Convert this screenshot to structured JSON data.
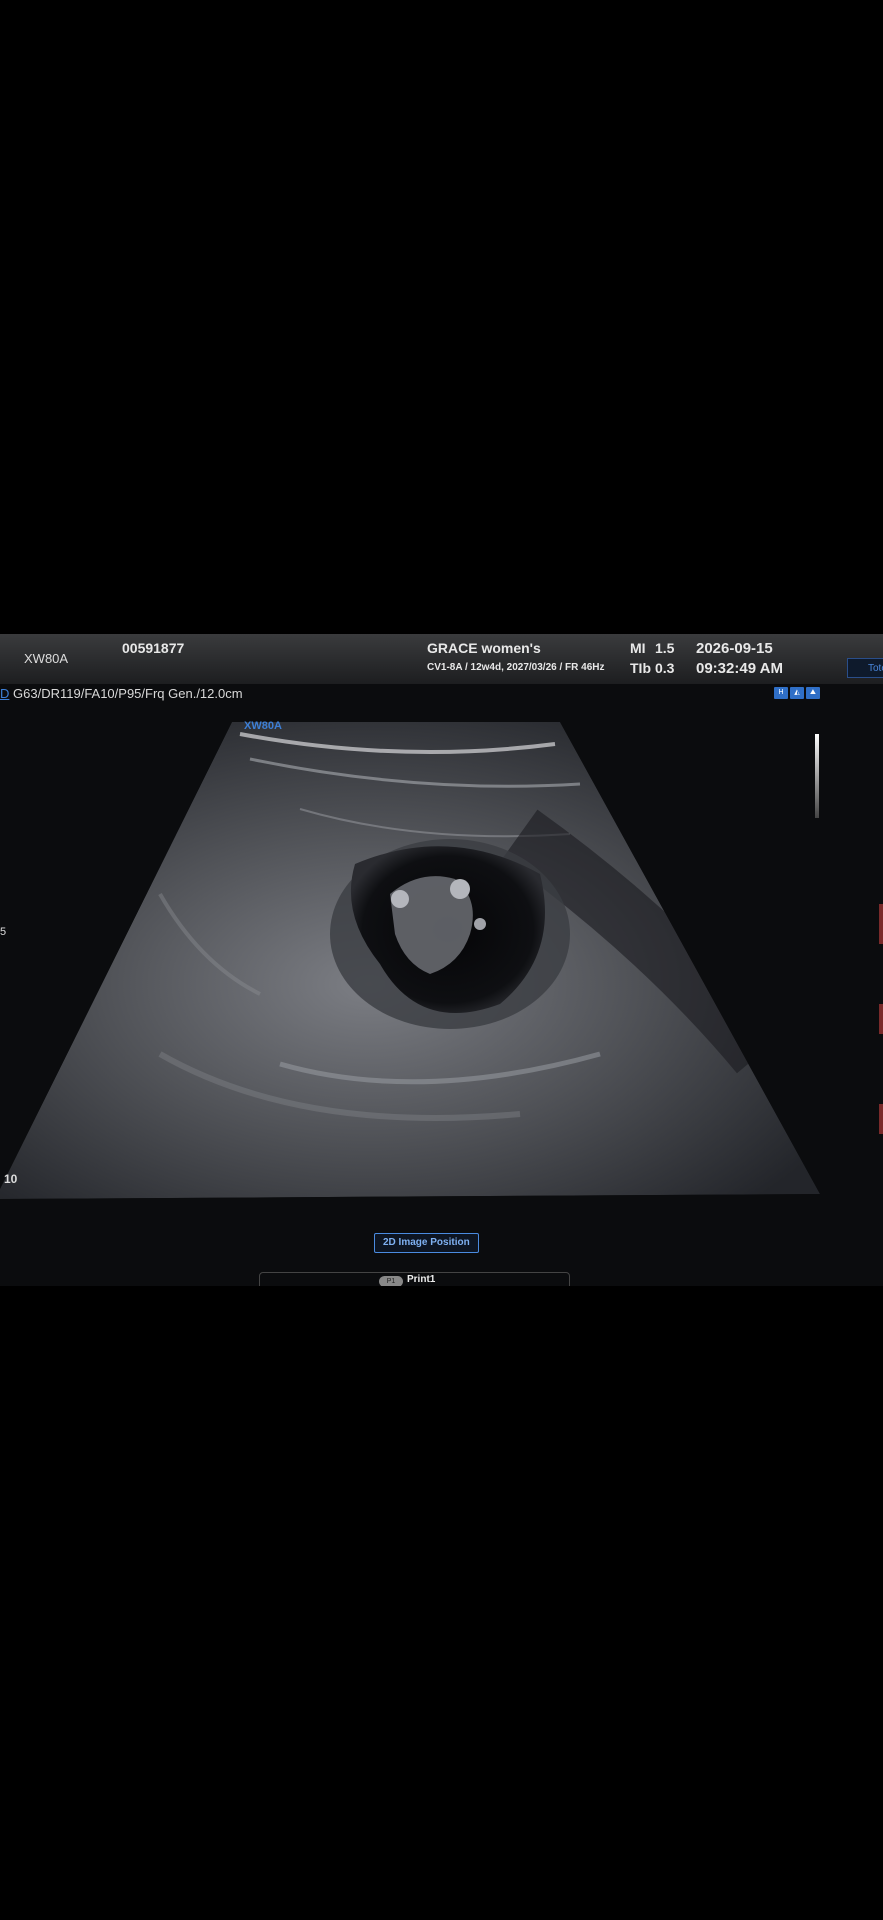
{
  "header": {
    "device_model": "XW80A",
    "patient_id": "00591877",
    "institution": "GRACE women's",
    "scan_info": "CV1-8A / 12w4d, 2027/03/26 / FR 46Hz",
    "mi_label": "MI",
    "mi_value": "1.5",
    "tib_label": "TIb",
    "tib_value": "0.3",
    "date": "2026-09-15",
    "time": "09:32:49 AM",
    "side_tab": "Tote"
  },
  "imaging": {
    "mode": "D",
    "params": "G63/DR119/FA10/P95/Frq Gen./12.0cm",
    "probe_tag": "XW80A",
    "depth_marker": "10",
    "side_marker": "5"
  },
  "controls": {
    "position_button": "2D Image Position",
    "print_pill": "P1",
    "print_label": "Print1"
  },
  "colors": {
    "accent": "#3d7fd6",
    "header_top": "#3a3b3d",
    "screen_bg": "#0b0c0e"
  }
}
